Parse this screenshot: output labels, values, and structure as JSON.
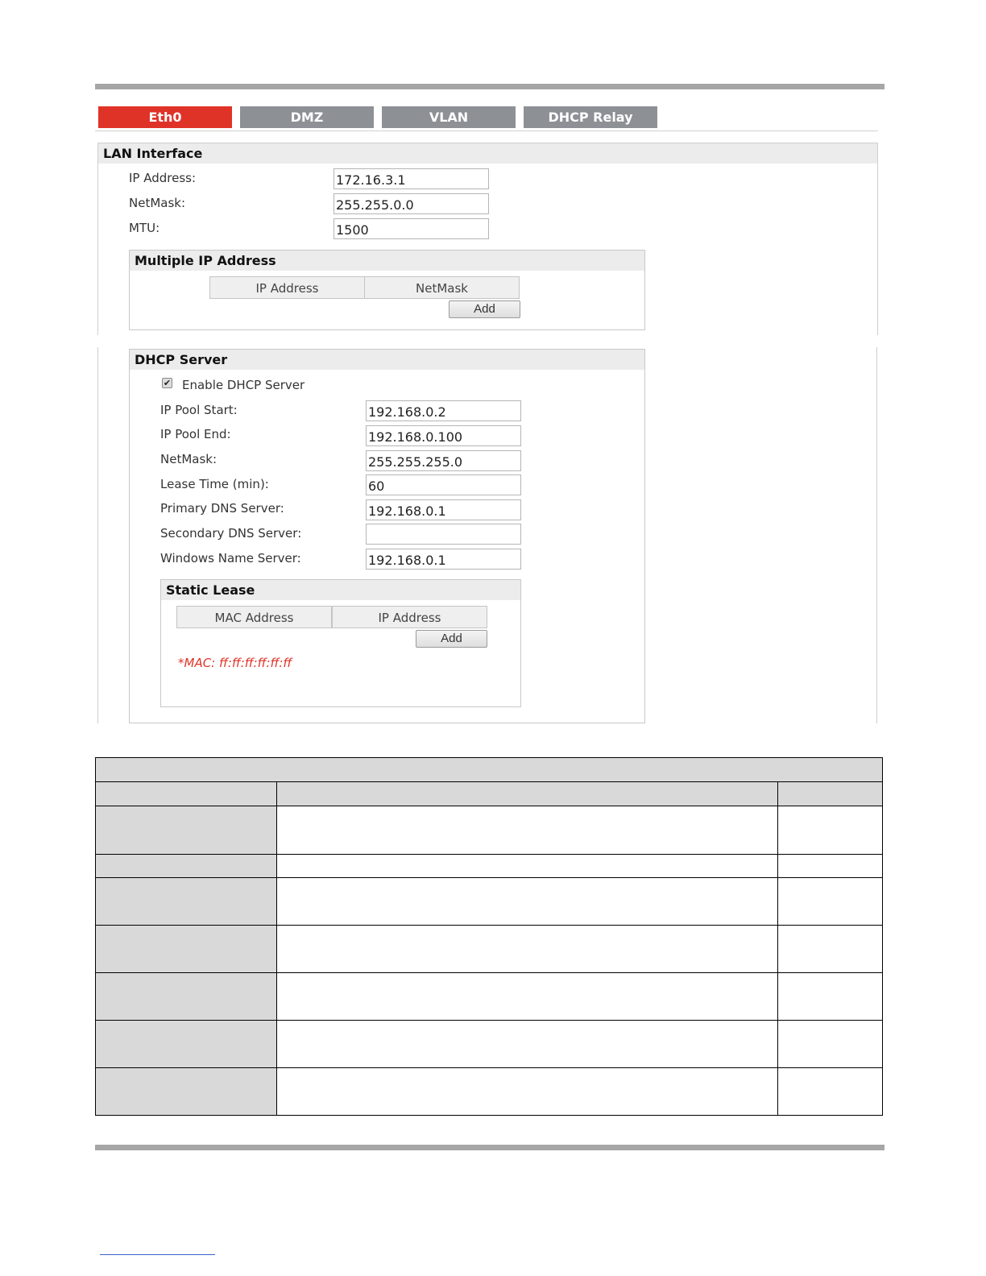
{
  "tabs": [
    {
      "label": "Eth0",
      "active": true
    },
    {
      "label": "DMZ",
      "active": false
    },
    {
      "label": "VLAN",
      "active": false
    },
    {
      "label": "DHCP Relay",
      "active": false
    }
  ],
  "lan": {
    "title": "LAN Interface",
    "ip_label": "IP Address:",
    "ip_value": "172.16.3.1",
    "netmask_label": "NetMask:",
    "netmask_value": "255.255.0.0",
    "mtu_label": "MTU:",
    "mtu_value": "1500"
  },
  "multi_ip": {
    "title": "Multiple IP Address",
    "col_ip": "IP Address",
    "col_netmask": "NetMask",
    "add_label": "Add"
  },
  "dhcp": {
    "title": "DHCP Server",
    "enable_label": "Enable DHCP Server",
    "enabled": true,
    "pool_start_label": "IP Pool Start:",
    "pool_start_value": "192.168.0.2",
    "pool_end_label": "IP Pool End:",
    "pool_end_value": "192.168.0.100",
    "netmask_label": "NetMask:",
    "netmask_value": "255.255.255.0",
    "lease_label": "Lease Time (min):",
    "lease_value": "60",
    "primary_dns_label": "Primary DNS Server:",
    "primary_dns_value": "192.168.0.1",
    "secondary_dns_label": "Secondary DNS Server:",
    "secondary_dns_value": "",
    "wins_label": "Windows Name Server:",
    "wins_value": "192.168.0.1"
  },
  "static_lease": {
    "title": "Static Lease",
    "col_mac": "MAC Address",
    "col_ip": "IP Address",
    "add_label": "Add",
    "hint": "*MAC: ff:ff:ff:ff:ff:ff"
  },
  "colors": {
    "active_tab": "#e03328",
    "inactive_tab": "#8d9095",
    "hint": "#e03328"
  }
}
